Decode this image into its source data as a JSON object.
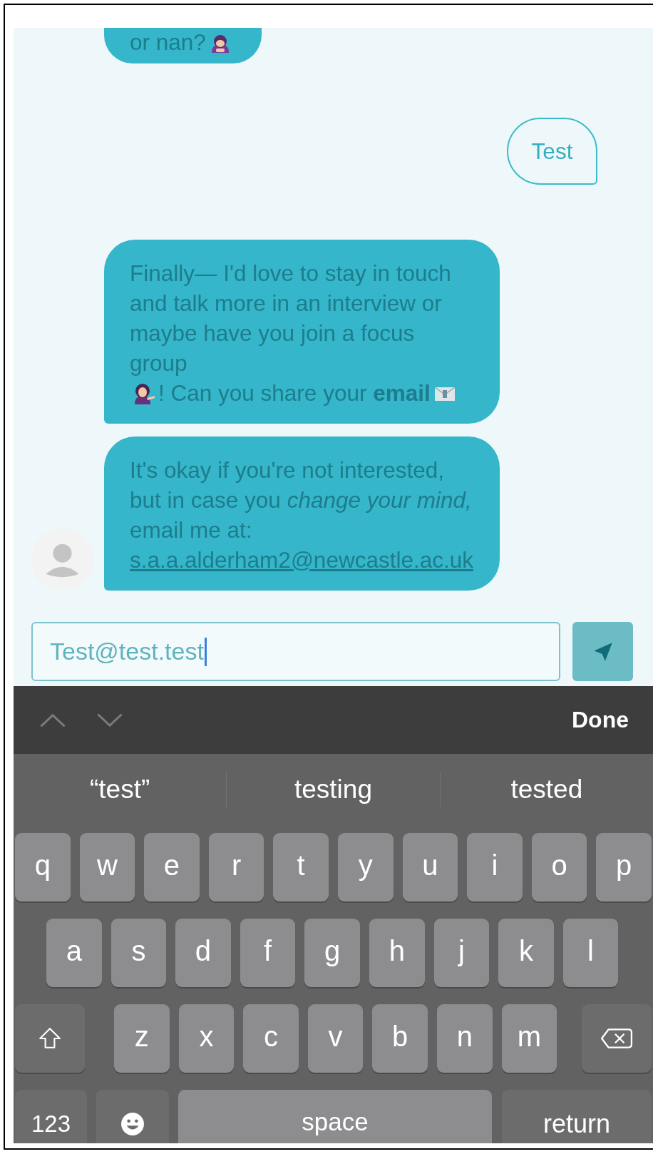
{
  "messages": [
    {
      "kind": "incoming",
      "parts": [
        {
          "kind": "text",
          "text": "or nan?"
        },
        {
          "kind": "emoji"
        }
      ]
    },
    {
      "kind": "outgoing",
      "parts": [
        {
          "kind": "text",
          "text": "Test"
        }
      ]
    },
    {
      "kind": "incoming",
      "parts": [
        {
          "kind": "text",
          "text": "Finally— I'd love to stay in touch and talk more in an interview or maybe have you join a focus group"
        },
        {
          "kind": "emoji"
        },
        {
          "kind": "text",
          "text": "! Can you share your **email**"
        },
        {
          "kind": "emoji"
        }
      ]
    },
    {
      "kind": "incoming",
      "avatar": true,
      "parts": [
        {
          "kind": "text",
          "text": "It's okay if you're not interested, but in case you *change your mind,* email me at:"
        },
        {
          "kind": "link",
          "text": "s.a.a.alderham2@newcastle.ac.uk"
        }
      ]
    }
  ],
  "composer": {
    "value": "Test@test.test"
  },
  "keyboard": {
    "done": "Done",
    "suggestions": [
      "“test”",
      "testing",
      "tested"
    ],
    "rows": [
      [
        {
          "kind": "letter",
          "label": "q"
        },
        {
          "kind": "letter",
          "label": "w"
        },
        {
          "kind": "letter",
          "label": "e"
        },
        {
          "kind": "letter",
          "label": "r"
        },
        {
          "kind": "letter",
          "label": "t"
        },
        {
          "kind": "letter",
          "label": "y"
        },
        {
          "kind": "letter",
          "label": "u"
        },
        {
          "kind": "letter",
          "label": "i"
        },
        {
          "kind": "letter",
          "label": "o"
        },
        {
          "kind": "letter",
          "label": "p"
        }
      ],
      [
        {
          "kind": "letter",
          "label": "a"
        },
        {
          "kind": "letter",
          "label": "s"
        },
        {
          "kind": "letter",
          "label": "d"
        },
        {
          "kind": "letter",
          "label": "f"
        },
        {
          "kind": "letter",
          "label": "g"
        },
        {
          "kind": "letter",
          "label": "h"
        },
        {
          "kind": "letter",
          "label": "j"
        },
        {
          "kind": "letter",
          "label": "k"
        },
        {
          "kind": "letter",
          "label": "l"
        }
      ],
      [
        {
          "kind": "shift"
        },
        {
          "kind": "letter",
          "label": "z"
        },
        {
          "kind": "letter",
          "label": "x"
        },
        {
          "kind": "letter",
          "label": "c"
        },
        {
          "kind": "letter",
          "label": "v"
        },
        {
          "kind": "letter",
          "label": "b"
        },
        {
          "kind": "letter",
          "label": "n"
        },
        {
          "kind": "letter",
          "label": "m"
        },
        {
          "kind": "delete"
        }
      ]
    ],
    "bottom_row": [
      {
        "kind": "numbers",
        "label": "123"
      },
      {
        "kind": "emoji"
      },
      {
        "kind": "space",
        "label": "space"
      },
      {
        "kind": "return",
        "label": "return"
      }
    ]
  }
}
